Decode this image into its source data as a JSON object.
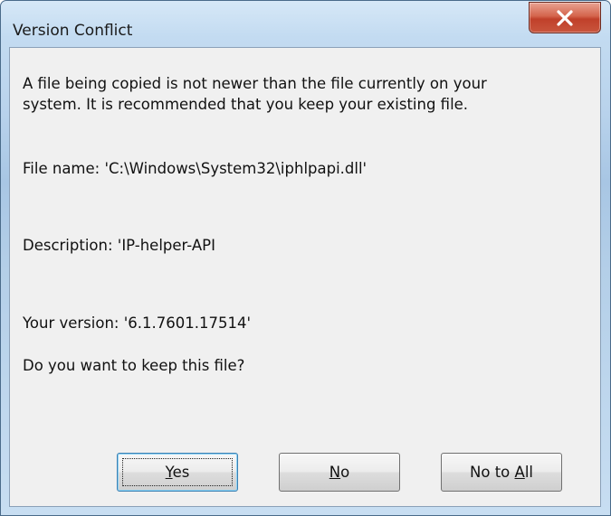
{
  "window": {
    "title": "Version Conflict"
  },
  "message": {
    "line1": "A file being copied is not newer than the file currently on your",
    "line2": "system. It is recommended that you keep your existing file.",
    "file_name": "File name:   'C:\\Windows\\System32\\iphlpapi.dll'",
    "description": "Description:  'IP-helper-API",
    "your_version": "Your version:  '6.1.7601.17514'",
    "question": "Do you want to keep this file?"
  },
  "buttons": {
    "yes": {
      "mnemonic": "Y",
      "rest": "es"
    },
    "no": {
      "mnemonic": "N",
      "rest": "o"
    },
    "no_to_all": {
      "prefix": "No to ",
      "mnemonic": "A",
      "rest": "ll"
    }
  },
  "icons": {
    "close": "close-icon"
  },
  "colors": {
    "close_button": "#c9553d",
    "dialog_background": "#f0f0f0",
    "frame": "#b9d3ec"
  }
}
